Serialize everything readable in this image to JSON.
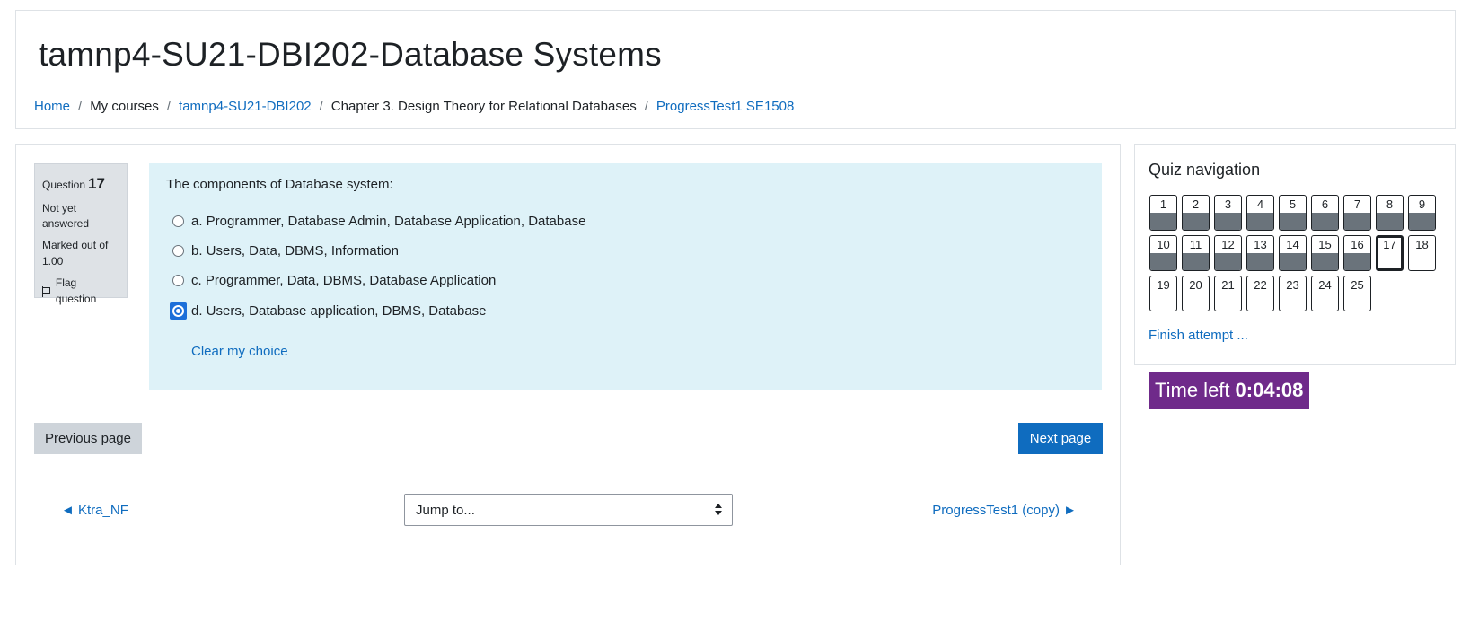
{
  "header": {
    "title": "tamnp4-SU21-DBI202-Database Systems",
    "breadcrumb": [
      {
        "label": "Home"
      },
      {
        "label": "My courses"
      },
      {
        "label": "tamnp4-SU21-DBI202"
      },
      {
        "label": "Chapter 3. Design Theory for Relational Databases"
      },
      {
        "label": "ProgressTest1 SE1508"
      }
    ],
    "separator": "/"
  },
  "question": {
    "prefix": "Question",
    "number": "17",
    "state": "Not yet answered",
    "grade": "Marked out of 1.00",
    "flag_label": "Flag question",
    "text": "The components of Database system:",
    "answers": [
      {
        "label": "a. Programmer, Database Admin, Database Application, Database",
        "selected": false
      },
      {
        "label": "b. Users, Data, DBMS, Information",
        "selected": false
      },
      {
        "label": "c. Programmer, Data, DBMS, Database Application",
        "selected": false
      },
      {
        "label": "d. Users, Database application, DBMS, Database",
        "selected": true
      }
    ],
    "clear_choice": "Clear my choice"
  },
  "buttons": {
    "previous": "Previous page",
    "next": "Next page"
  },
  "activity_nav": {
    "prev_link": "◄ Ktra_NF",
    "jump_placeholder": "Jump to...",
    "next_link": "ProgressTest1 (copy) ►"
  },
  "quiz_nav": {
    "title": "Quiz navigation",
    "questions": [
      {
        "n": "1",
        "answered": true
      },
      {
        "n": "2",
        "answered": true
      },
      {
        "n": "3",
        "answered": true
      },
      {
        "n": "4",
        "answered": true
      },
      {
        "n": "5",
        "answered": true
      },
      {
        "n": "6",
        "answered": true
      },
      {
        "n": "7",
        "answered": true
      },
      {
        "n": "8",
        "answered": true
      },
      {
        "n": "9",
        "answered": true
      },
      {
        "n": "10",
        "answered": true
      },
      {
        "n": "11",
        "answered": true
      },
      {
        "n": "12",
        "answered": true
      },
      {
        "n": "13",
        "answered": true
      },
      {
        "n": "14",
        "answered": true
      },
      {
        "n": "15",
        "answered": true
      },
      {
        "n": "16",
        "answered": true
      },
      {
        "n": "17",
        "answered": false,
        "current": true
      },
      {
        "n": "18",
        "answered": false
      },
      {
        "n": "19",
        "answered": false
      },
      {
        "n": "20",
        "answered": false
      },
      {
        "n": "21",
        "answered": false
      },
      {
        "n": "22",
        "answered": false
      },
      {
        "n": "23",
        "answered": false
      },
      {
        "n": "24",
        "answered": false
      },
      {
        "n": "25",
        "answered": false
      }
    ],
    "finish_attempt": "Finish attempt ..."
  },
  "timer": {
    "label": "Time left",
    "value": "0:04:08"
  },
  "colors": {
    "link": "#0f6cbf",
    "question_bg": "#def2f8",
    "info_bg": "#dee2e6",
    "timer_bg": "#6f2a8a",
    "answered_fill": "#6a737b"
  }
}
